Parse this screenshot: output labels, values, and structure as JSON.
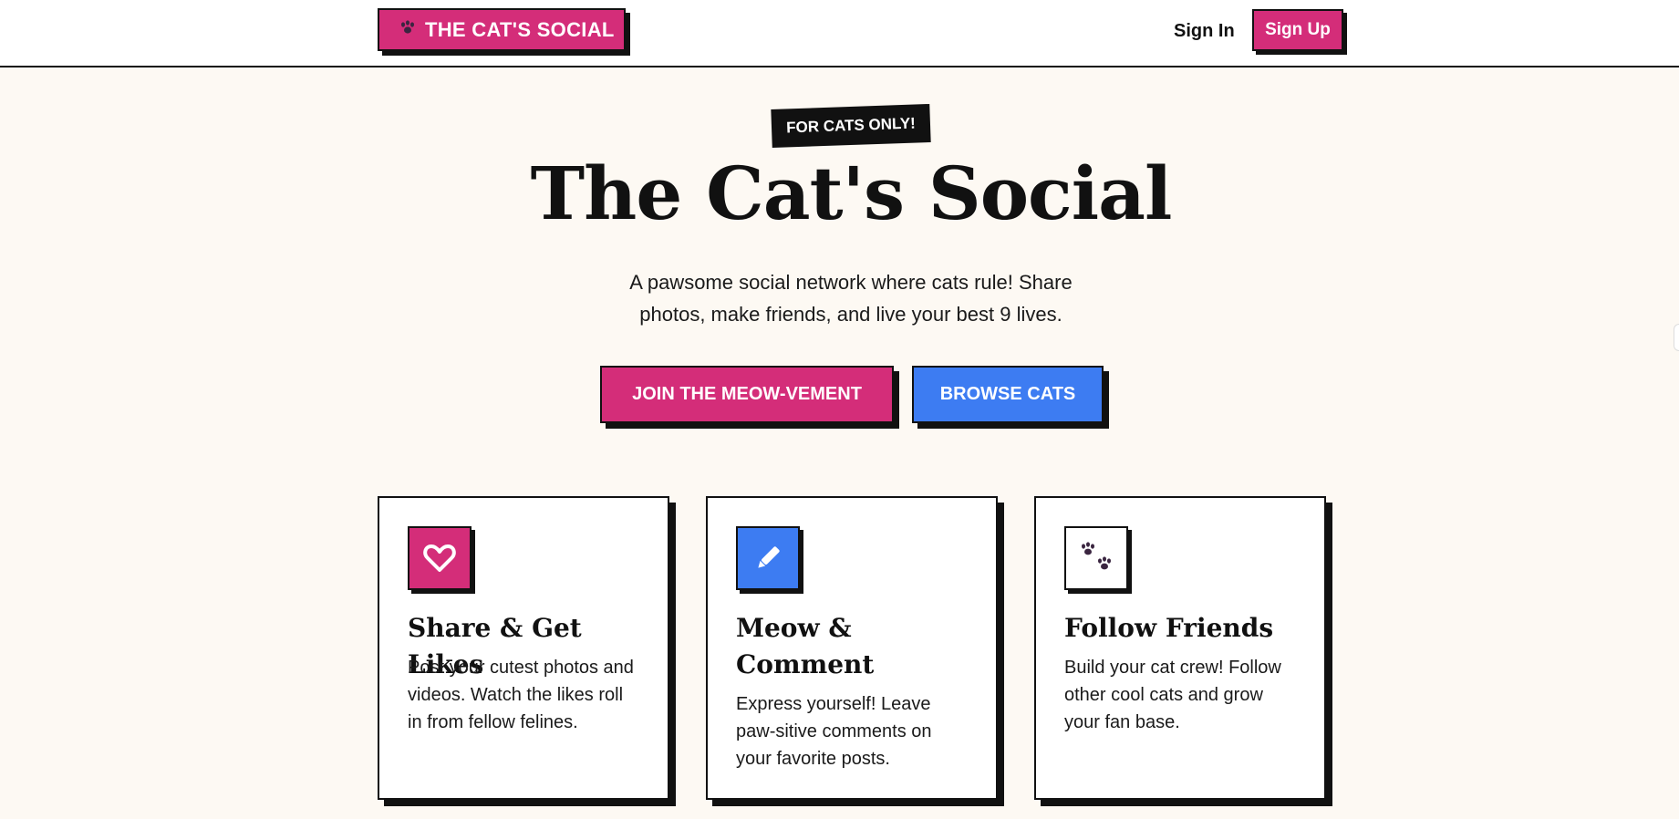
{
  "nav": {
    "logo_icon": "paw-icon",
    "logo_text": "THE CAT'S SOCIAL",
    "signin_label": "Sign In",
    "signup_label": "Sign Up"
  },
  "hero": {
    "badge": "FOR CATS ONLY!",
    "title": "The Cat's Social",
    "subtitle": "A pawsome social network where cats rule! Share photos, make friends, and live your best 9 lives.",
    "primary_button": "JOIN THE MEOW-VEMENT",
    "secondary_button": "BROWSE CATS"
  },
  "features": [
    {
      "icon": "heart-icon",
      "title": "Share & Get Likes",
      "text": "Post your cutest photos and videos. Watch the likes roll in from fellow felines."
    },
    {
      "icon": "pencil-icon",
      "title": "Meow & Comment",
      "text": "Express yourself! Leave paw-sitive comments on your favorite posts."
    },
    {
      "icon": "paws-icon",
      "title": "Follow Friends",
      "text": "Build your cat crew! Follow other cool cats and grow your fan base."
    }
  ],
  "colors": {
    "brand_pink": "#d42d79",
    "accent_blue": "#3d7cf2",
    "background": "#fdf9f3",
    "ink": "#111111"
  }
}
